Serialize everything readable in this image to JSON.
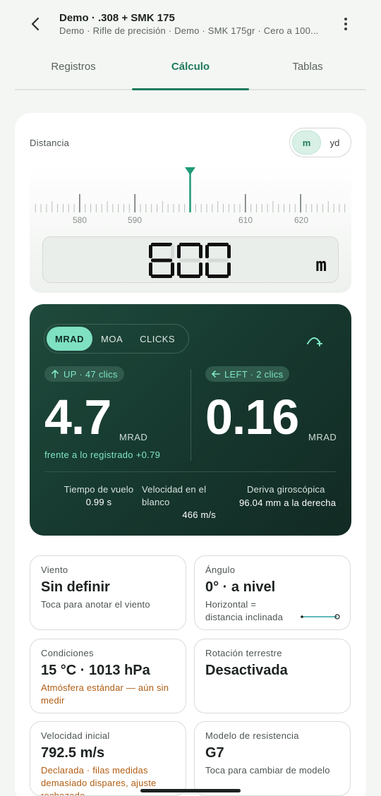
{
  "header": {
    "title": "Demo · .308 + SMK 175",
    "subtitle": "Demo · Rifle de precisión · Demo · SMK 175gr · Cero a 100..."
  },
  "tabs": [
    {
      "label": "Registros",
      "active": false
    },
    {
      "label": "Cálculo",
      "active": true
    },
    {
      "label": "Tablas",
      "active": false
    }
  ],
  "distance": {
    "label": "Distancia",
    "units": [
      "m",
      "yd"
    ],
    "selected_unit": "m",
    "value": "600",
    "value_unit": "m",
    "ruler_ticks": [
      "580",
      "590",
      "610",
      "620"
    ]
  },
  "result": {
    "modes": [
      "MRAD",
      "MOA",
      "CLICKS"
    ],
    "selected_mode": "MRAD",
    "elevation_chip": "UP · 47 clics",
    "elevation_value": "4.7",
    "elevation_unit": "MRAD",
    "windage_chip": "LEFT · 2 clics",
    "windage_value": "0.16",
    "windage_unit": "MRAD",
    "compare": "frente a lo registrado +0.79",
    "stats": [
      {
        "label": "Tiempo de vuelo",
        "value": "0.99 s"
      },
      {
        "label": "Velocidad en el blanco",
        "value": "466 m/s"
      },
      {
        "label": "Deriva giroscópica",
        "value": "96.04 mm a la derecha"
      }
    ]
  },
  "tiles": {
    "wind": {
      "label": "Viento",
      "value": "Sin definir",
      "sub": "Toca para anotar el viento"
    },
    "angle": {
      "label": "Ángulo",
      "value": "0° · a nivel",
      "sub": "Horizontal = distancia inclinada"
    },
    "conditions": {
      "label": "Condiciones",
      "value": "15 °C · 1013 hPa",
      "sub": "Atmósfera estándar — aún sin medir"
    },
    "rotation": {
      "label": "Rotación terrestre",
      "value": "Desactivada"
    },
    "muzzle": {
      "label": "Velocidad inicial",
      "value": "792.5 m/s",
      "sub": "Declarada · filas medidas demasiado dispares, ajuste rechazado"
    },
    "drag": {
      "label": "Modelo de resistencia",
      "value": "G7",
      "sub": "Toca para cambiar de modelo"
    }
  },
  "colors": {
    "accent": "#1f7a5e",
    "panel": "#173a30",
    "highlight": "#7fe0c2",
    "warning": "#b15d12"
  }
}
